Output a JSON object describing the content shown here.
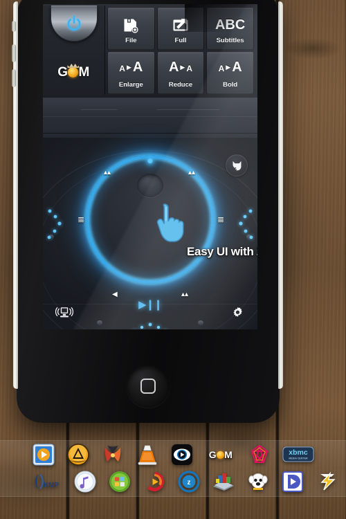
{
  "app": {
    "brand": "GOM",
    "tagline": "Easy UI with Zog Dial.",
    "power_label": "power-button"
  },
  "toolbar": {
    "buttons": [
      {
        "label": "File",
        "icon": "floppy-disk-plus-icon"
      },
      {
        "label": "Full",
        "icon": "fullscreen-expand-icon"
      },
      {
        "label": "Subtitles",
        "icon": "abc-text-icon",
        "glyph": "ABC"
      },
      {
        "label": "Enlarge",
        "icon": "font-enlarge-icon",
        "small": "A",
        "arrow": "▶",
        "big": "A"
      },
      {
        "label": "Reduce",
        "icon": "font-reduce-icon",
        "small": "A",
        "arrow": "▶",
        "big": "A"
      },
      {
        "label": "Bold",
        "icon": "font-bold-icon",
        "small": "A",
        "arrow": "▶",
        "big": "A"
      }
    ]
  },
  "dial": {
    "ring_color": "#38a8e8",
    "play_pause_glyph": "▶❙❙",
    "knob": "dial-center-knob",
    "position_dot": "dial-position-indicator",
    "cursor": "hand-pointer-cursor",
    "ticks": [
      {
        "name": "tick-skip-forward-tr",
        "glyph": "▴▴"
      },
      {
        "name": "tick-skip-back-tl",
        "glyph": "▴▴"
      },
      {
        "name": "tick-speed-down-left",
        "glyph": "≣"
      },
      {
        "name": "tick-speed-up-right",
        "glyph": "≣"
      },
      {
        "name": "tick-volume-bl",
        "glyph": "◀"
      },
      {
        "name": "tick-aspect-br",
        "glyph": "▴▴"
      }
    ],
    "buttons": [
      {
        "name": "pet-button",
        "icon": "cat-head-icon"
      },
      {
        "name": "cast-button",
        "icon": "monitor-cast-icon"
      },
      {
        "name": "settings-button",
        "icon": "gear-icon"
      }
    ]
  },
  "phone": {
    "home_button": "home-button",
    "speaker": "earpiece-speaker",
    "side_buttons": [
      "silent-switch",
      "volume-up-button",
      "volume-down-button"
    ]
  },
  "dock": {
    "row1": [
      {
        "name": "dock-icon-mxplayer",
        "label": "",
        "kind": "mx"
      },
      {
        "name": "dock-icon-potplayer",
        "label": "",
        "kind": "pot"
      },
      {
        "name": "dock-icon-bsplayer",
        "label": "",
        "kind": "bs"
      },
      {
        "name": "dock-icon-vlc",
        "label": "",
        "kind": "vlc"
      },
      {
        "name": "dock-icon-kmplayer",
        "label": "",
        "kind": "kmp2"
      },
      {
        "name": "dock-icon-gom",
        "label": "GOM",
        "kind": "gomtext"
      },
      {
        "name": "dock-icon-divx",
        "label": "",
        "kind": "divx"
      },
      {
        "name": "dock-icon-xbmc",
        "label": "xbmc",
        "kind": "xbmc"
      }
    ],
    "row2": [
      {
        "name": "dock-icon-kmp",
        "label": "KMP",
        "kind": "kmptext"
      },
      {
        "name": "dock-icon-itunes",
        "label": "",
        "kind": "itunes"
      },
      {
        "name": "dock-icon-wmp",
        "label": "",
        "kind": "wmp"
      },
      {
        "name": "dock-icon-realplayer",
        "label": "",
        "kind": "real"
      },
      {
        "name": "dock-icon-zoomplayer",
        "label": "z",
        "kind": "zoom"
      },
      {
        "name": "dock-icon-nero",
        "label": "",
        "kind": "nero"
      },
      {
        "name": "dock-icon-powerdvd",
        "label": "",
        "kind": "dog"
      },
      {
        "name": "dock-icon-daum",
        "label": "",
        "kind": "daum"
      },
      {
        "name": "dock-icon-winamp",
        "label": "",
        "kind": "winamp"
      }
    ]
  }
}
